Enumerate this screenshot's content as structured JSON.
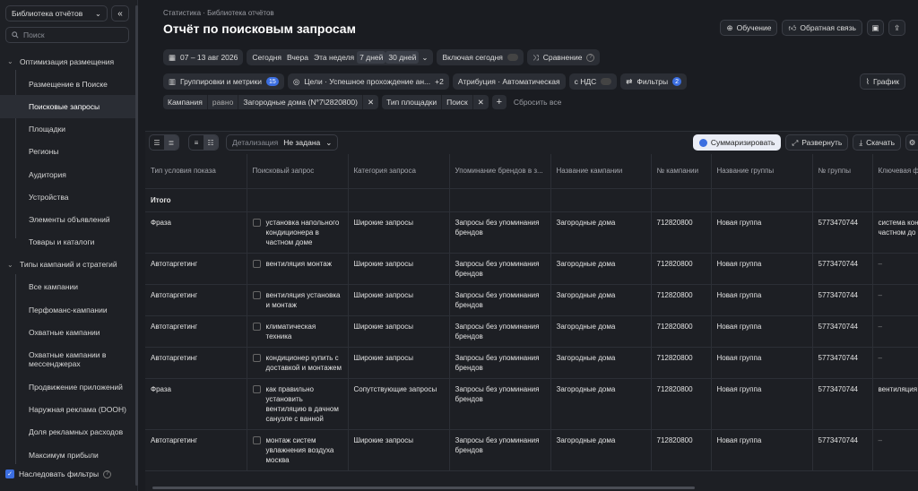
{
  "sidebar": {
    "library_label": "Библиотека отчётов",
    "search_placeholder": "Поиск",
    "groups": [
      {
        "label": "Оптимизация размещения",
        "items": [
          "Размещение в Поиске",
          "Поисковые запросы",
          "Площадки",
          "Регионы",
          "Аудитория",
          "Устройства",
          "Элементы объявлений",
          "Товары и каталоги"
        ]
      },
      {
        "label": "Типы кампаний и стратегий",
        "items": [
          "Все кампании",
          "Перфоманс-кампании",
          "Охватные кампании",
          "Охватные кампании в мессенджерах",
          "Продвижение приложений",
          "Наружная реклама (DOOH)",
          "Доля рекламных расходов",
          "Максимум прибыли"
        ]
      }
    ],
    "inherit_filters_label": "Наследовать фильтры"
  },
  "header": {
    "breadcrumb": "Статистика · Библиотека отчётов",
    "title": "Отчёт по поисковым запросам",
    "learn_label": "Обучение",
    "feedback_label": "Обратная связь"
  },
  "period": {
    "date_range": "07 – 13 авг 2026",
    "presets": [
      "Сегодня",
      "Вчера",
      "Эта неделя",
      "7 дней",
      "30 дней"
    ],
    "include_today": "Включая сегодня",
    "compare": "Сравнение"
  },
  "controls": {
    "groupings": "Группировки и метрики",
    "groupings_count": "15",
    "goals": "Цели · Успешное прохождение ан...",
    "goals_extra": "+2",
    "attribution": "Атрибуция · Автоматическая",
    "vat": "с НДС",
    "filters": "Фильтры",
    "filters_count": "2",
    "chart": "График"
  },
  "filters": {
    "f1_field": "Кампания",
    "f1_op": "равно",
    "f1_value": "Загородные дома (N°7\\2820800)",
    "f2_field": "Тип площадки",
    "f2_value": "Поиск",
    "reset": "Сбросить все"
  },
  "toolbar": {
    "detail_label": "Детализация",
    "detail_value": "Не задана",
    "summarize": "Суммаризировать",
    "expand": "Развернуть",
    "download": "Скачать"
  },
  "table": {
    "columns": [
      "Тип условия показа",
      "Поисковый запрос",
      "Категория запроса",
      "Упоминание брендов в з...",
      "Название кампании",
      "№ кампании",
      "Название группы",
      "№ группы",
      "Ключевая ф"
    ],
    "total_label": "Итого",
    "rows": [
      [
        "Фраза",
        "установка напольного кондиционера в частном доме",
        "Широкие запросы",
        "Запросы без упоминания брендов",
        "Загородные дома",
        "712820800",
        "Новая группа",
        "5773470744",
        "система кондицион частном до"
      ],
      [
        "Автотаргетинг",
        "вентиляция монтаж",
        "Широкие запросы",
        "Запросы без упоминания брендов",
        "Загородные дома",
        "712820800",
        "Новая группа",
        "5773470744",
        "–"
      ],
      [
        "Автотаргетинг",
        "вентиляция установка и монтаж",
        "Широкие запросы",
        "Запросы без упоминания брендов",
        "Загородные дома",
        "712820800",
        "Новая группа",
        "5773470744",
        "–"
      ],
      [
        "Автотаргетинг",
        "климатическая техника",
        "Широкие запросы",
        "Запросы без упоминания брендов",
        "Загородные дома",
        "712820800",
        "Новая группа",
        "5773470744",
        "–"
      ],
      [
        "Автотаргетинг",
        "кондиционер купить с доставкой и монтажем",
        "Широкие запросы",
        "Запросы без упоминания брендов",
        "Загородные дома",
        "712820800",
        "Новая группа",
        "5773470744",
        "–"
      ],
      [
        "Фраза",
        "как правильно установить вентиляцию в дачном санузле с ванной",
        "Сопутствующие запросы",
        "Запросы без упоминания брендов",
        "Загородные дома",
        "712820800",
        "Новая группа",
        "5773470744",
        "вентиляция"
      ],
      [
        "Автотаргетинг",
        "монтаж систем увлажнения воздуха москва",
        "Широкие запросы",
        "Запросы без упоминания брендов",
        "Загородные дома",
        "712820800",
        "Новая группа",
        "5773470744",
        "–"
      ]
    ]
  }
}
